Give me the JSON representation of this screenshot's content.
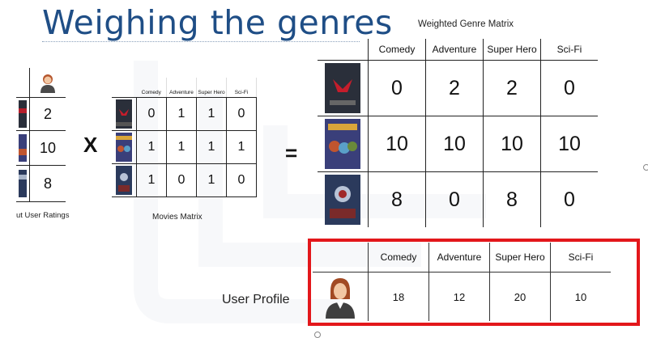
{
  "title": "Weighing the genres",
  "genres": [
    "Comedy",
    "Adventure",
    "Super Hero",
    "Sci-Fi"
  ],
  "movies_genres_small": [
    "Comedy",
    "Adventure",
    "Super Hero",
    "Sci-Fi"
  ],
  "ratings": {
    "caption": "ut User Ratings",
    "values": [
      "2",
      "10",
      "8"
    ]
  },
  "operators": {
    "times": "X",
    "equals": "="
  },
  "movies_matrix": {
    "caption": "Movies Matrix",
    "rows": [
      [
        "0",
        "1",
        "1",
        "0"
      ],
      [
        "1",
        "1",
        "1",
        "1"
      ],
      [
        "1",
        "0",
        "1",
        "0"
      ]
    ]
  },
  "weighted_matrix": {
    "title": "Weighted Genre Matrix",
    "rows": [
      [
        "0",
        "2",
        "2",
        "0"
      ],
      [
        "10",
        "10",
        "10",
        "10"
      ],
      [
        "8",
        "0",
        "8",
        "0"
      ]
    ]
  },
  "user_profile": {
    "label": "User Profile",
    "values": [
      "18",
      "12",
      "20",
      "10"
    ]
  },
  "colors": {
    "title": "#1f4e86",
    "highlight_border": "#e3171b",
    "poster_1": "#2a2f3a",
    "poster_2": "#3a3f7a",
    "poster_3": "#2b3a5c"
  },
  "icons": [
    "user-avatar-icon",
    "movie-poster-batman-v-superman",
    "movie-poster-guardians-of-the-galaxy",
    "movie-poster-captain-america-civil-war"
  ]
}
